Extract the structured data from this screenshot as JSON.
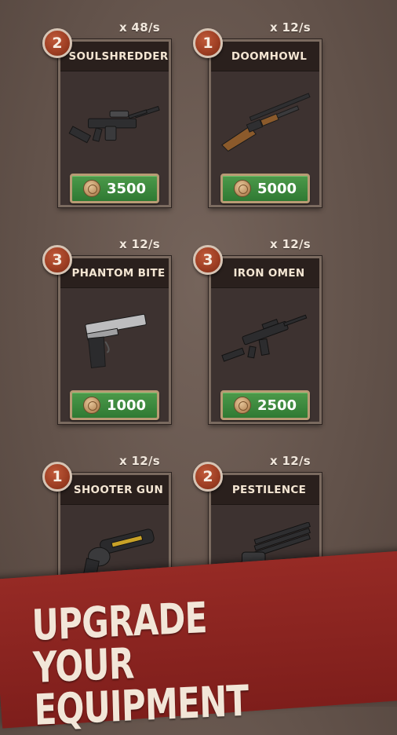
{
  "weapons": [
    {
      "name": "SOULSHREDDER",
      "level": "2",
      "rate": "x 48/s",
      "price": "3500",
      "icon": "assault-rifle-icon"
    },
    {
      "name": "DOOMHOWL",
      "level": "1",
      "rate": "x 12/s",
      "price": "5000",
      "icon": "shotgun-icon"
    },
    {
      "name": "PHANTOM BITE",
      "level": "3",
      "rate": "x 12/s",
      "price": "1000",
      "icon": "pistol-icon"
    },
    {
      "name": "IRON OMEN",
      "level": "3",
      "rate": "x 12/s",
      "price": "2500",
      "icon": "carbine-icon"
    },
    {
      "name": "SHOOTER GUN",
      "level": "1",
      "rate": "x 12/s",
      "price": "",
      "icon": "revolver-icon"
    },
    {
      "name": "PESTILENCE",
      "level": "2",
      "rate": "x 12/s",
      "price": "",
      "icon": "minigun-icon"
    }
  ],
  "banner": {
    "line1": "UPGRADE YOUR",
    "line2": "EQUIPMENT"
  },
  "colors": {
    "background": "#6a5a52",
    "banner": "#8a2320",
    "button": "#3c8a3c",
    "level_badge": "#9c3d22"
  }
}
